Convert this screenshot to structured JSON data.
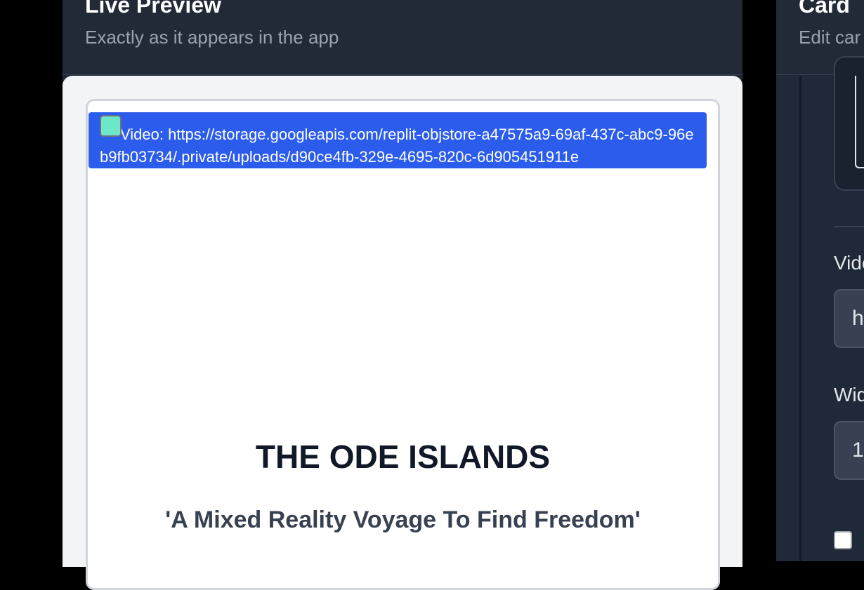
{
  "preview": {
    "title": "Live Preview",
    "subtitle": "Exactly as it appears in the app",
    "video_banner": {
      "icon": "video-icon",
      "text": "Video: https://storage.googleapis.com/replit-objstore-a47575a9-69af-437c-abc9-96eb9fb03734/.private/uploads/d90ce4fb-329e-4695-820c-6d905451911e"
    },
    "card_title": "THE ODE ISLANDS",
    "card_subtitle": "'A Mixed Reality Voyage To Find Freedom'"
  },
  "editor": {
    "title": "Card",
    "subtitle": "Edit car",
    "fields": [
      {
        "label": "Vide",
        "value": "h"
      },
      {
        "label": "Wid",
        "value": "1"
      }
    ],
    "checkbox_checked": false
  },
  "colors": {
    "panel_bg": "#1f2937",
    "banner_blue": "#2b5cec",
    "icon_mint": "#6ee7c9"
  }
}
